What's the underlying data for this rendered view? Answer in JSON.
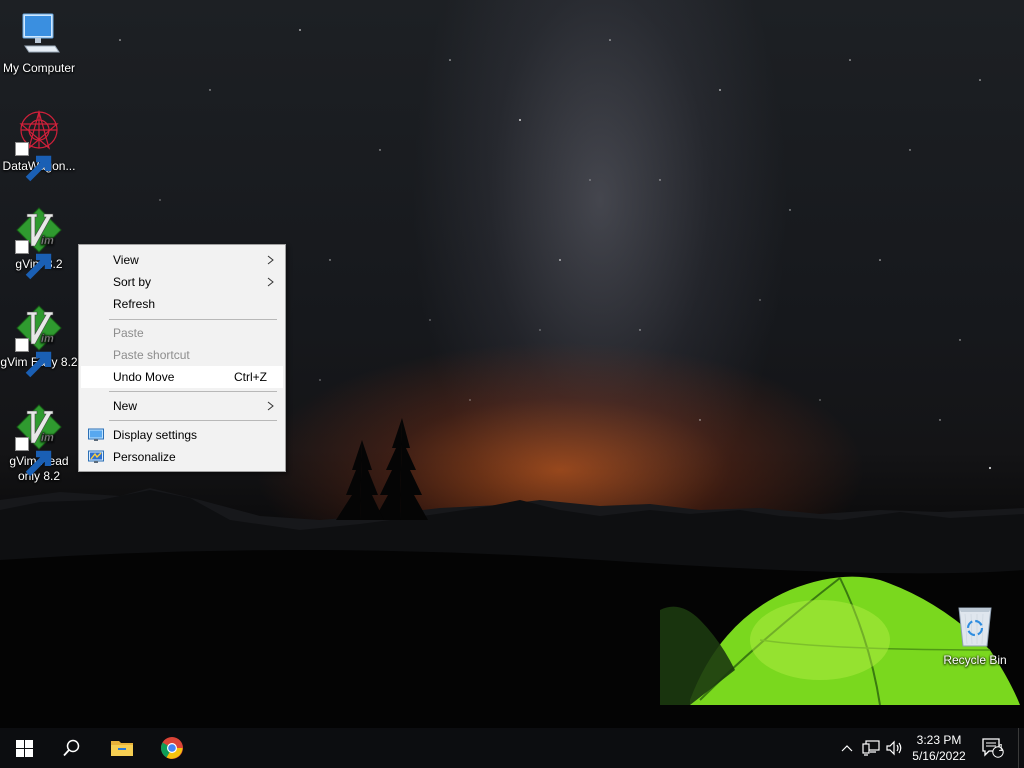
{
  "desktop": {
    "icons": [
      {
        "label": "My Computer",
        "icon": "computer-icon"
      },
      {
        "label": "DataWagon...",
        "icon": "datawagon-icon"
      },
      {
        "label": "gVim 8.2",
        "icon": "vim-icon"
      },
      {
        "label": "gVim Easy 8.2",
        "icon": "vim-icon"
      },
      {
        "label": "gVim Read only 8.2",
        "icon": "vim-icon"
      },
      {
        "label": "Recycle Bin",
        "icon": "recycle-bin-icon"
      }
    ]
  },
  "context_menu": {
    "view": "View",
    "sort_by": "Sort by",
    "refresh": "Refresh",
    "paste": "Paste",
    "paste_shortcut": "Paste shortcut",
    "undo_move": "Undo Move",
    "undo_move_shortcut": "Ctrl+Z",
    "new": "New",
    "display_settings": "Display settings",
    "personalize": "Personalize"
  },
  "taskbar": {
    "time": "3:23 PM",
    "date": "5/16/2022",
    "notification_count": "1",
    "pinned": [
      "start-icon",
      "search-icon",
      "file-explorer-icon",
      "chrome-icon"
    ]
  },
  "colors": {
    "menu_bg": "#f2f2f2",
    "menu_hover": "#ffffff",
    "taskbar_bg": "#0c0d10",
    "vim_green": "#2f9a2f",
    "tent_green": "#7ad81e"
  }
}
